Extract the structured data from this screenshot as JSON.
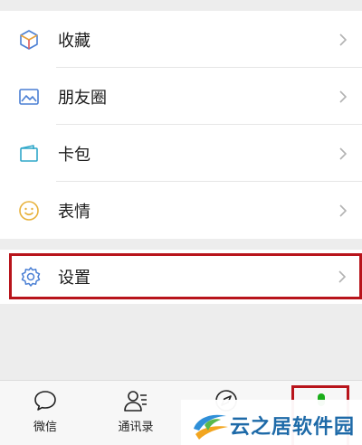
{
  "menu": {
    "items": [
      {
        "label": "收藏",
        "icon": "cube-icon"
      },
      {
        "label": "朋友圈",
        "icon": "photo-icon"
      },
      {
        "label": "卡包",
        "icon": "card-wallet-icon"
      },
      {
        "label": "表情",
        "icon": "smiley-icon"
      }
    ]
  },
  "settings": {
    "label": "设置",
    "icon": "gear-icon",
    "highlight_color": "#b8141b"
  },
  "tabbar": {
    "tabs": [
      {
        "label": "微信",
        "icon": "chat-bubble-icon"
      },
      {
        "label": "通讯录",
        "icon": "contacts-icon"
      },
      {
        "label": "",
        "icon": "compass-icon"
      },
      {
        "label": "",
        "icon": "me-icon"
      }
    ]
  },
  "watermark": {
    "text": "云之居软件园"
  },
  "colors": {
    "accent_green": "#1aad19",
    "highlight_red": "#b8141b",
    "watermark_blue": "#1e6aa8"
  }
}
